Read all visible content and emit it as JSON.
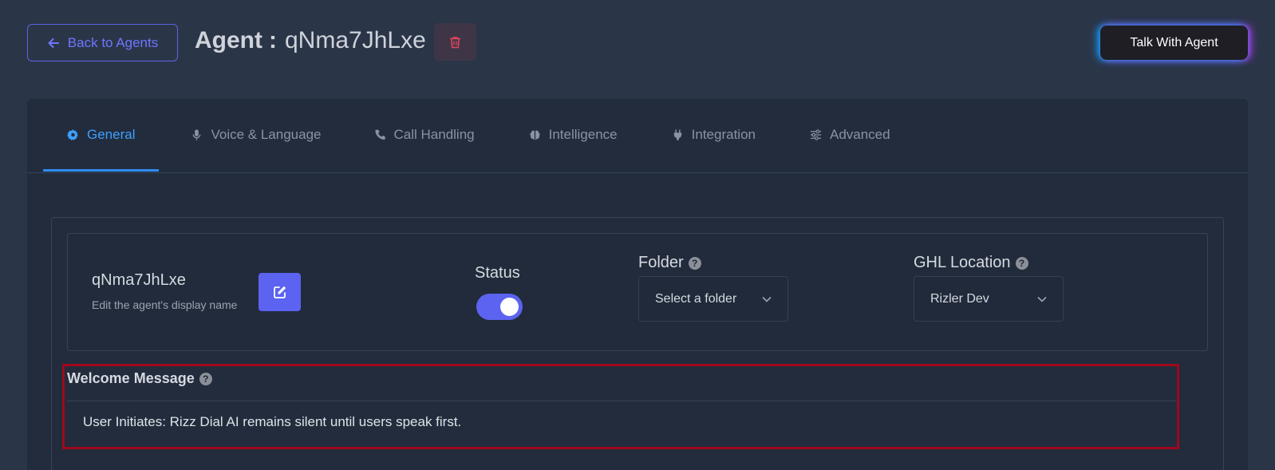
{
  "header": {
    "back_label": "Back to Agents",
    "title_label": "Agent",
    "title_sep": ":",
    "agent_id": "qNma7JhLxe",
    "talk_label": "Talk With Agent"
  },
  "tabs": [
    {
      "label": "General",
      "icon": "gear-icon",
      "active": true
    },
    {
      "label": "Voice & Language",
      "icon": "microphone-icon",
      "active": false
    },
    {
      "label": "Call Handling",
      "icon": "phone-icon",
      "active": false
    },
    {
      "label": "Intelligence",
      "icon": "brain-icon",
      "active": false
    },
    {
      "label": "Integration",
      "icon": "plug-icon",
      "active": false
    },
    {
      "label": "Advanced",
      "icon": "sliders-icon",
      "active": false
    }
  ],
  "general": {
    "agent_name": "qNma7JhLxe",
    "agent_name_hint": "Edit the agent's display name",
    "status_label": "Status",
    "status_enabled": true,
    "folder_label": "Folder",
    "folder_value": "Select a folder",
    "ghl_label": "GHL Location",
    "ghl_value": "Rizler Dev",
    "help_glyph": "?",
    "welcome_label": "Welcome Message",
    "welcome_value": "User Initiates: Rizz Dial AI remains silent until users speak first."
  },
  "colors": {
    "accent": "#5b63f0",
    "tab_active": "#3ea0ff",
    "danger": "#e0445c",
    "highlight_border": "#a0071c"
  }
}
